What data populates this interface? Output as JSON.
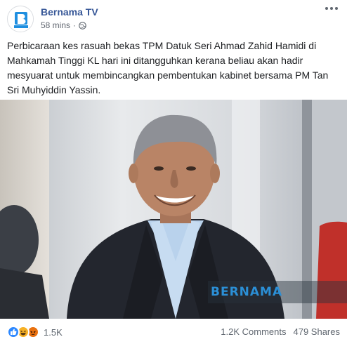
{
  "post": {
    "page_name": "Bernama TV",
    "time": "58 mins",
    "separator": "·",
    "text": "Perbicaraan kes rasuah bekas TPM Datuk Seri Ahmad Zahid Hamidi di Mahkamah Tinggi KL hari ini ditangguhkan kerana beliau akan hadir mesyuarat untuk membincangkan pembentukan kabinet bersama PM Tan Sri Muhyiddin Yassin.",
    "more_icon": "ellipsis-icon",
    "privacy_icon": "globe-icon"
  },
  "photo": {
    "watermark": "BERNAMA"
  },
  "footer": {
    "reactions": [
      "like-icon",
      "haha-icon",
      "angry-icon"
    ],
    "reaction_count": "1.5K",
    "comments": "1.2K Comments",
    "shares": "479 Shares"
  },
  "colors": {
    "link": "#385898",
    "meta": "#616770",
    "like": "#2d88ff",
    "haha": "#f7b125",
    "angry": "#e9710f",
    "watermark": "#2b8fd6"
  }
}
